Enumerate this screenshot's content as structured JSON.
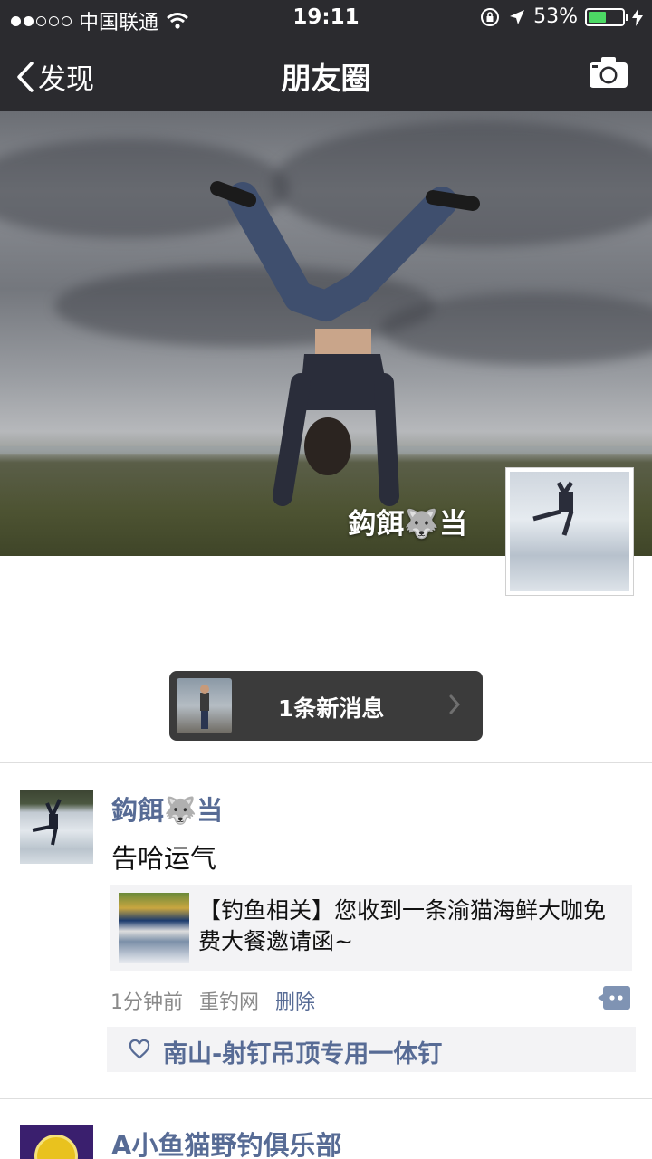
{
  "status_bar": {
    "carrier": "中国联通",
    "time": "19:11",
    "battery_percent": "53%",
    "battery_level": 0.53,
    "signal_dots_filled": 2,
    "signal_dots_total": 5
  },
  "nav": {
    "back_label": "发现",
    "title": "朋友圈"
  },
  "cover": {
    "user_name": "鈎餌🐺当"
  },
  "new_message": {
    "label": "1条新消息"
  },
  "post": {
    "author": "鈎餌🐺当",
    "text": "告哈运气",
    "link_title": "【钓鱼相关】您收到一条渝猫海鲜大咖免费大餐邀请函~",
    "time": "1分钟前",
    "source": "重钓网",
    "delete_label": "删除",
    "liker": "南山-射钉吊顶专用一体钉"
  },
  "next_post": {
    "author": "A小鱼猫野钓俱乐部"
  },
  "colors": {
    "bar_bg": "#2b2b2f",
    "link_blue": "#576b95",
    "battery_green": "#4cd964"
  }
}
